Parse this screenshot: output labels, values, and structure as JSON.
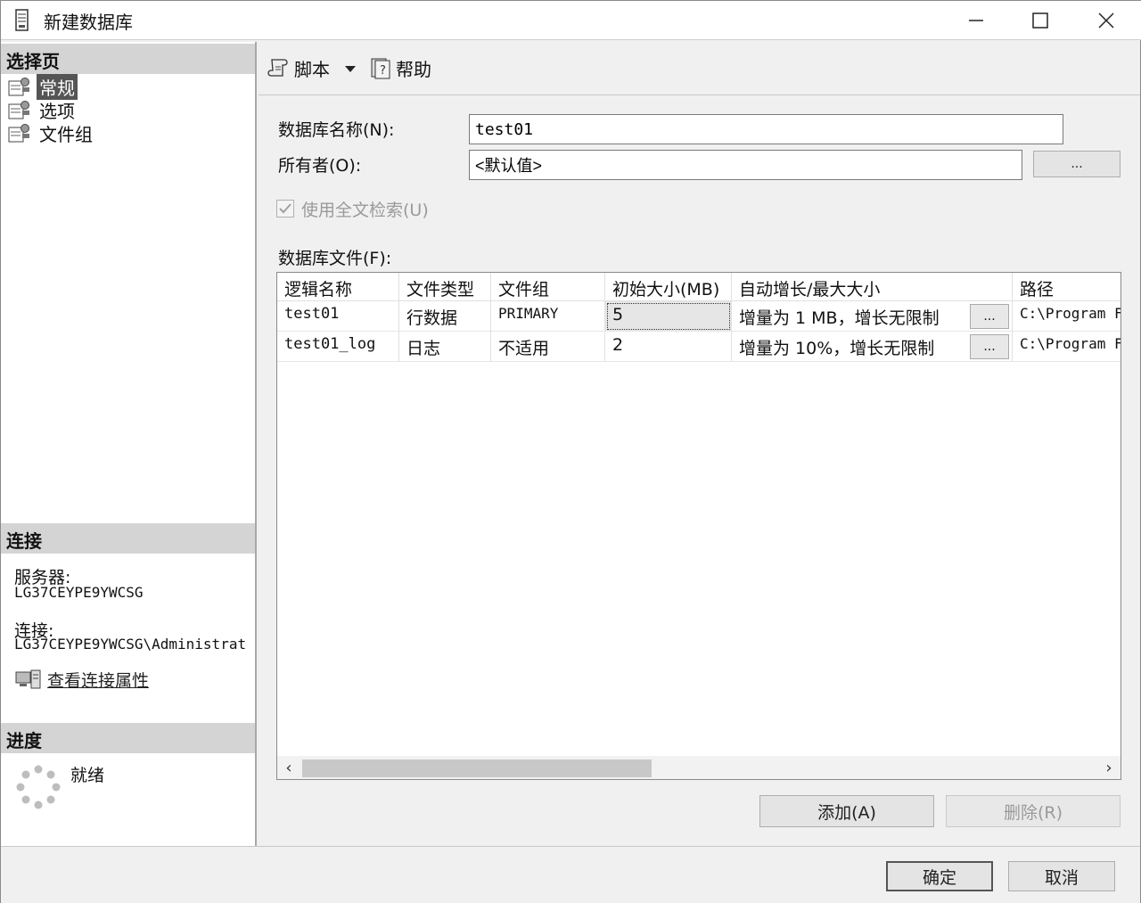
{
  "window": {
    "title": "新建数据库",
    "minimize_glyph": "—",
    "maximize_glyph": "☐",
    "close_glyph": "✕"
  },
  "left": {
    "select_page_header": "选择页",
    "pages": [
      {
        "label": "常规",
        "icon": "settings-page-icon",
        "selected": true
      },
      {
        "label": "选项",
        "icon": "settings-page-icon",
        "selected": false
      },
      {
        "label": "文件组",
        "icon": "settings-page-icon",
        "selected": false
      }
    ],
    "connection_header": "连接",
    "server_label": "服务器:",
    "server_value": "LG37CEYPE9YWCSG",
    "connection_label": "连接:",
    "connection_value": "LG37CEYPE9YWCSG\\Administrat",
    "view_connection_props": "查看连接属性",
    "progress_header": "进度",
    "progress_status": "就绪"
  },
  "toolbar": {
    "script_label": "脚本",
    "help_label": "帮助"
  },
  "form": {
    "db_name_label": "数据库名称(N):",
    "db_name_value": "test01",
    "owner_label": "所有者(O):",
    "owner_value": "<默认值>",
    "owner_browse": "...",
    "fulltext_label": "使用全文检索(U)",
    "files_label": "数据库文件(F):"
  },
  "grid": {
    "columns": [
      "逻辑名称",
      "文件类型",
      "文件组",
      "初始大小(MB)",
      "自动增长/最大大小",
      "路径"
    ],
    "rows": [
      {
        "name": "test01",
        "type": "行数据",
        "filegroup": "PRIMARY",
        "size": "5",
        "growth": "增量为 1 MB，增长无限制",
        "browse": "...",
        "path": "C:\\Program F"
      },
      {
        "name": "test01_log",
        "type": "日志",
        "filegroup": "不适用",
        "size": "2",
        "growth": "增量为 10%，增长无限制",
        "browse": "...",
        "path": "C:\\Program F"
      }
    ],
    "scroll_left": "‹",
    "scroll_right": "›"
  },
  "actions": {
    "add_label": "添加(A)",
    "remove_label": "删除(R)",
    "ok_label": "确定",
    "cancel_label": "取消"
  }
}
